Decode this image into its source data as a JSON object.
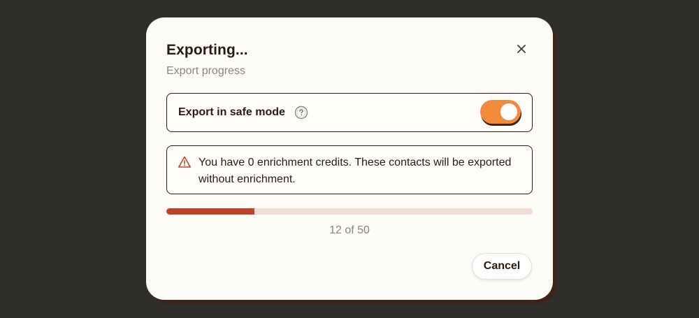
{
  "dialog": {
    "title": "Exporting...",
    "subtitle": "Export progress",
    "close_icon": "close-icon"
  },
  "safe_mode": {
    "label": "Export in safe mode",
    "help_icon": "question-circle-icon",
    "enabled": true
  },
  "warning": {
    "icon": "warning-triangle-icon",
    "text": "You have 0 enrichment credits. These contacts will be exported without enrichment."
  },
  "progress": {
    "current": 12,
    "total": 50,
    "text": "12 of 50"
  },
  "actions": {
    "cancel_label": "Cancel"
  },
  "colors": {
    "backdrop": "#2f2e2b",
    "dialog_bg": "#fdfbf6",
    "accent_orange": "#f28a3c",
    "progress_fill": "#bb4426",
    "progress_track": "#f0dcd2",
    "text_dark": "#2b1a10",
    "text_muted": "#8a8580"
  }
}
